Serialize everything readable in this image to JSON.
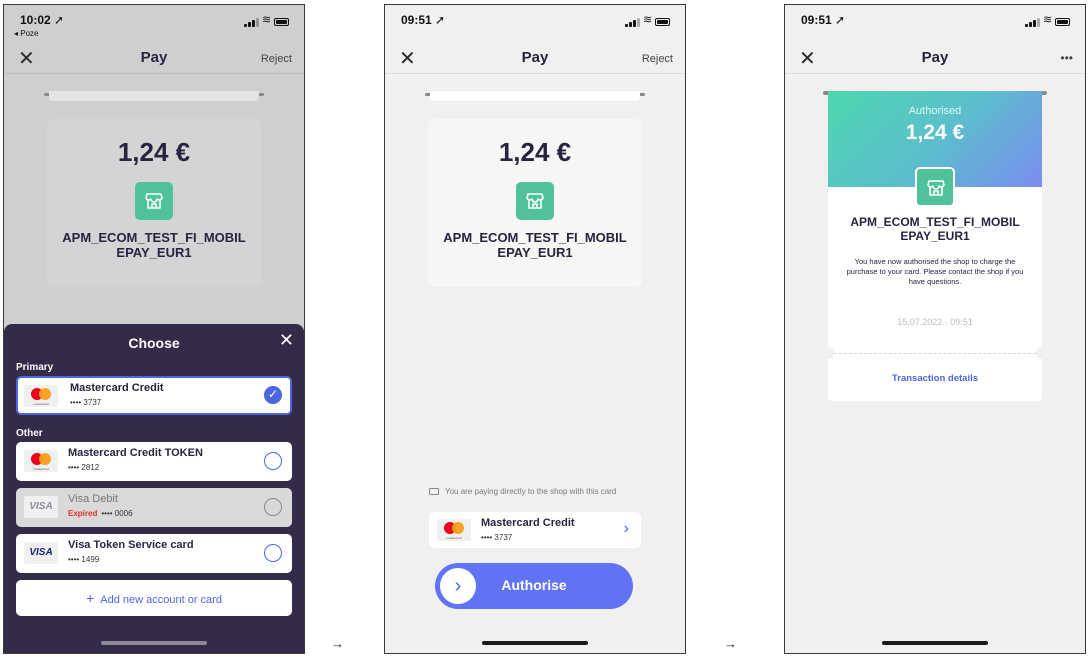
{
  "common": {
    "page_title": "Pay",
    "amount": "1,24 €",
    "merchant": "APM_ECOM_TEST_FI_MOBILEPAY_EUR1",
    "close_glyph": "✕"
  },
  "arrows": [
    "→",
    "→"
  ],
  "screen1": {
    "time": "10:02 ➚",
    "back_app": "◂ Poze",
    "nav_right": "Reject",
    "sheet": {
      "title": "Choose",
      "primary_label": "Primary",
      "other_label": "Other",
      "cards": [
        {
          "name": "Mastercard Credit",
          "number": "•••• 3737",
          "brand": "mastercard",
          "selected": true
        },
        {
          "name": "Mastercard Credit TOKEN",
          "number": "•••• 2812",
          "brand": "mastercard",
          "selected": false
        },
        {
          "name": "Visa Debit",
          "status": "Expired",
          "number": "•••• 0006",
          "brand": "visa",
          "disabled": true
        },
        {
          "name": "Visa Token Service card",
          "number": "•••• 1499",
          "brand": "visa",
          "selected": false
        }
      ],
      "add_label": "Add new account or card",
      "add_plus": "+"
    }
  },
  "screen2": {
    "time": "09:51 ➚",
    "nav_right": "Reject",
    "paying_note": "You are paying directly to the shop with this card",
    "card_name": "Mastercard Credit",
    "card_number": "•••• 3737",
    "card_chevron": "›",
    "authorise_label": "Authorise",
    "authorise_knob": "›"
  },
  "screen3": {
    "time": "09:51 ➚",
    "nav_right": "•••",
    "status": "Authorised",
    "message": "You have now authorised the shop to charge the purchase to your card. Please contact the shop if you have questions.",
    "date": "15.07.2022 · 09:51",
    "details_link": "Transaction details"
  },
  "brands": {
    "mastercard_small_text": "mastercard",
    "visa_text": "VISA"
  },
  "colors": {
    "accent": "#4b67e0",
    "button": "#6173f5",
    "shop_green": "#4fc29a",
    "sheet_bg": "#332b47",
    "expired": "#e0302a"
  },
  "icons": [
    "signal-icon",
    "wifi-icon",
    "battery-icon",
    "close-icon",
    "shop-icon",
    "checkmark-icon",
    "chevron-right-icon",
    "card-icon",
    "more-icon"
  ]
}
